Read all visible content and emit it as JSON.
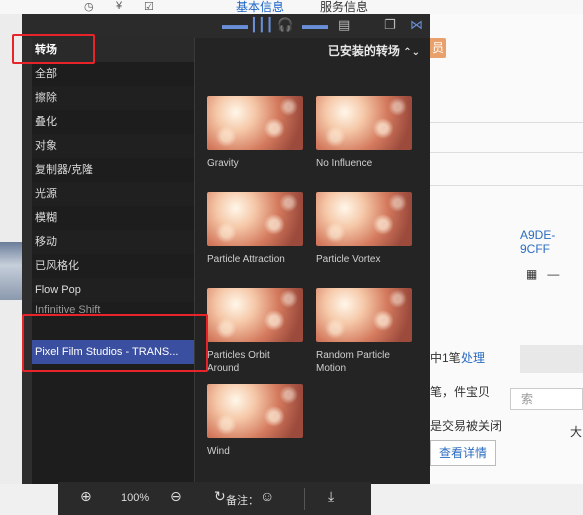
{
  "background": {
    "tabs": [
      "基本信息",
      "服务信息"
    ],
    "member_badge": "员",
    "id_text": "A9DE-9CFF",
    "row1_text": "中1笔",
    "row1_link": "处理",
    "row2_text": "笔，件宝贝",
    "row3_text": "是交易被关闭",
    "search_placeholder": "索",
    "detail_button": "查看详情",
    "big_char": "大"
  },
  "toolbar": {
    "icons": [
      "filmstrip-icon",
      "waveform-icon",
      "headphones-icon",
      "clips-icon",
      "film-icon",
      "window-icon",
      "bowtie-icon"
    ]
  },
  "sidebar": {
    "header": "转场",
    "items": [
      {
        "label": "全部"
      },
      {
        "label": "擦除"
      },
      {
        "label": "叠化"
      },
      {
        "label": "对象"
      },
      {
        "label": "复制器/克隆"
      },
      {
        "label": "光源"
      },
      {
        "label": "模糊"
      },
      {
        "label": "移动"
      },
      {
        "label": "已风格化"
      },
      {
        "label": "Flow Pop"
      },
      {
        "label": "Infinitive Shift"
      },
      {
        "label": "Pixel Film Studios - TRANS..."
      }
    ]
  },
  "browser": {
    "title": "已安装的转场",
    "transitions": [
      {
        "name": "Gravity"
      },
      {
        "name": "No Influence"
      },
      {
        "name": "Particle Attraction"
      },
      {
        "name": "Particle Vortex"
      },
      {
        "name": "Particles Orbit Around"
      },
      {
        "name": "Random Particle Motion"
      },
      {
        "name": "Wind"
      }
    ]
  },
  "bottombar": {
    "zoom": "100%",
    "note_label": "备注："
  }
}
